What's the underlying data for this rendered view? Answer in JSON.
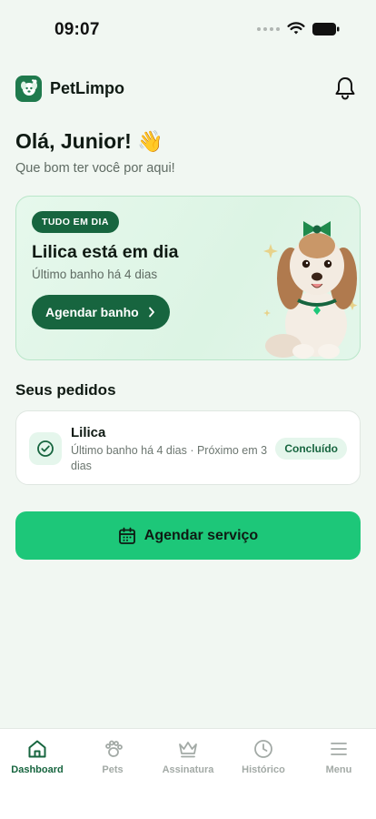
{
  "status_bar": {
    "time": "09:07"
  },
  "header": {
    "brand": "PetLimpo",
    "logo_icon": "dog-icon",
    "bell_icon": "bell-icon"
  },
  "greeting": {
    "title": "Olá, Junior! 👋",
    "subtitle": "Que bom ter você por aqui!"
  },
  "hero": {
    "badge": "TUDO EM DIA",
    "title": "Lilica está em dia",
    "subtitle": "Último banho há 4 dias",
    "button_label": "Agendar banho",
    "button_icon": "chevron-right-icon"
  },
  "orders": {
    "section_title": "Seus pedidos",
    "items": [
      {
        "pet": "Lilica",
        "description": "Último banho há 4 dias · Próximo em 3 dias",
        "status": "Concluído",
        "icon": "check-circle-icon"
      }
    ]
  },
  "cta": {
    "label": "Agendar serviço",
    "icon": "calendar-icon"
  },
  "bottom_nav": {
    "items": [
      {
        "label": "Dashboard",
        "icon": "home-icon",
        "active": true
      },
      {
        "label": "Pets",
        "icon": "paw-icon",
        "active": false
      },
      {
        "label": "Assinatura",
        "icon": "crown-icon",
        "active": false
      },
      {
        "label": "Histórico",
        "icon": "clock-icon",
        "active": false
      },
      {
        "label": "Menu",
        "icon": "menu-icon",
        "active": false
      }
    ]
  },
  "colors": {
    "brand_dark": "#17653f",
    "brand_bright": "#1dc779",
    "background": "#f1f7f2"
  }
}
